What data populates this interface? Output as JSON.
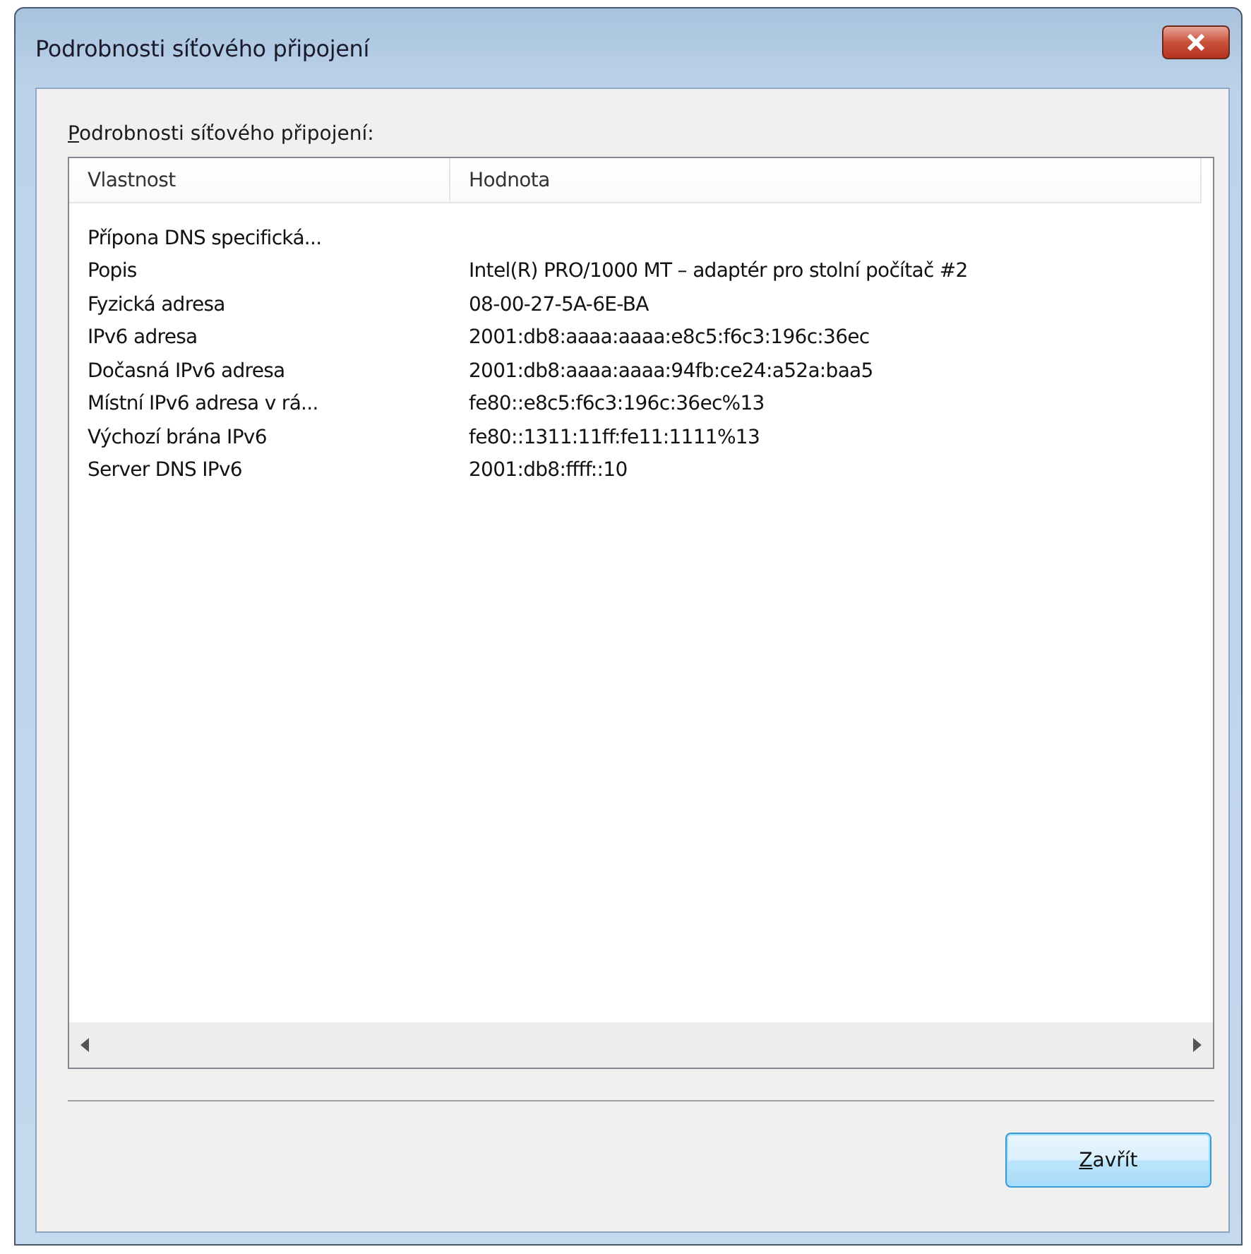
{
  "window": {
    "title": "Podrobnosti síťového připojení"
  },
  "section_label": "Podrobnosti síťového připojení:",
  "table": {
    "columns": [
      "Vlastnost",
      "Hodnota"
    ],
    "rows": [
      {
        "property": "Přípona DNS specifická..."
      },
      {
        "property": "Popis",
        "value": "Intel(R) PRO/1000 MT – adaptér pro stolní počítač #2"
      },
      {
        "property": "Fyzická adresa",
        "value": "08-00-27-5A-6E-BA"
      },
      {
        "property": "IPv6 adresa",
        "value": "2001:db8:aaaa:aaaa:e8c5:f6c3:196c:36ec"
      },
      {
        "property": "Dočasná IPv6 adresa",
        "value": "2001:db8:aaaa:aaaa:94fb:ce24:a52a:baa5"
      },
      {
        "property": "Místní IPv6 adresa v rá...",
        "value": "fe80::e8c5:f6c3:196c:36ec%13"
      },
      {
        "property": "Výchozí brána IPv6",
        "value": "fe80::1311:11ff:fe11:1111%13"
      },
      {
        "property": "Server DNS IPv6",
        "value": "2001:db8:ffff::10"
      }
    ]
  },
  "buttons": [
    "Zavřít"
  ]
}
